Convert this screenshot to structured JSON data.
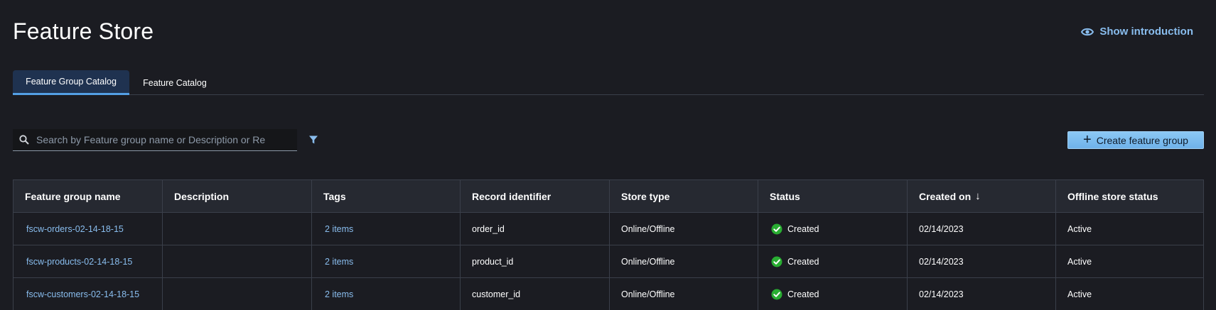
{
  "page": {
    "title": "Feature Store",
    "show_intro_label": "Show introduction"
  },
  "tabs": [
    {
      "label": "Feature Group Catalog",
      "active": true
    },
    {
      "label": "Feature Catalog",
      "active": false
    }
  ],
  "search": {
    "placeholder": "Search by Feature group name or Description or Re",
    "value": ""
  },
  "toolbar": {
    "create_label": "Create feature group"
  },
  "table": {
    "columns": [
      "Feature group name",
      "Description",
      "Tags",
      "Record identifier",
      "Store type",
      "Status",
      "Created on",
      "Offline store status"
    ],
    "sort_indicator": "↓",
    "rows": [
      {
        "name": "fscw-orders-02-14-18-15",
        "description": "",
        "tags": "2 items",
        "record_identifier": "order_id",
        "store_type": "Online/Offline",
        "status": "Created",
        "created_on": "02/14/2023",
        "offline_status": "Active"
      },
      {
        "name": "fscw-products-02-14-18-15",
        "description": "",
        "tags": "2 items",
        "record_identifier": "product_id",
        "store_type": "Online/Offline",
        "status": "Created",
        "created_on": "02/14/2023",
        "offline_status": "Active"
      },
      {
        "name": "fscw-customers-02-14-18-15",
        "description": "",
        "tags": "2 items",
        "record_identifier": "customer_id",
        "store_type": "Online/Offline",
        "status": "Created",
        "created_on": "02/14/2023",
        "offline_status": "Active"
      }
    ]
  },
  "colors": {
    "background": "#1b1c22",
    "link": "#89bdee",
    "accent_button": "#7ab8ee",
    "success": "#29ad32",
    "tab_active_bg": "#1f3250"
  },
  "icons": {
    "intro": "eye-icon",
    "search": "search-icon",
    "filter": "filter-icon",
    "create": "plus-icon",
    "status": "check-circle-icon"
  }
}
